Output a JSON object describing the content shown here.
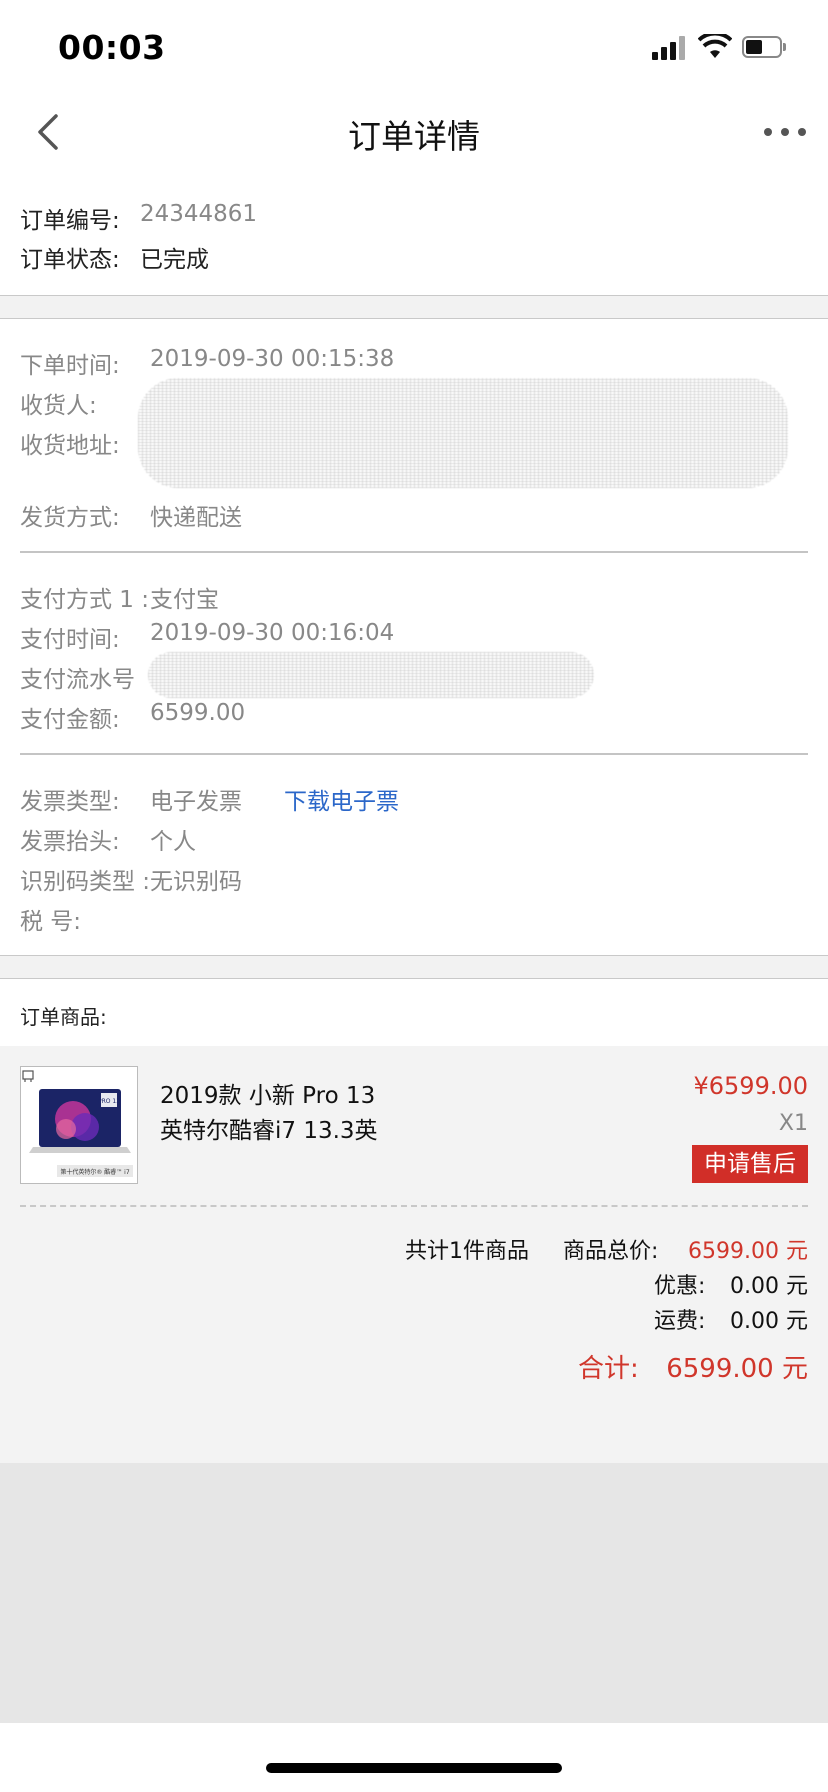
{
  "status_bar": {
    "time": "00:03"
  },
  "nav": {
    "title": "订单详情"
  },
  "order": {
    "number_label": "订单编号:",
    "number_value": "24344861",
    "status_label": "订单状态:",
    "status_value": "已完成"
  },
  "delivery": {
    "order_time_label": "下单时间:",
    "order_time_value": "2019-09-30 00:15:38",
    "receiver_label": "收货人:",
    "address_label": "收货地址:",
    "ship_method_label": "发货方式:",
    "ship_method_value": "快递配送"
  },
  "payment": {
    "method_label": "支付方式 1 :",
    "method_value": "支付宝",
    "time_label": "支付时间:",
    "time_value": "2019-09-30 00:16:04",
    "serial_label": "支付流水号",
    "amount_label": "支付金额:",
    "amount_value": "6599.00"
  },
  "invoice": {
    "type_label": "发票类型:",
    "type_value": "电子发票",
    "download_link": "下载电子票",
    "title_label": "发票抬头:",
    "title_value": "个人",
    "code_type_label": "识别码类型 :",
    "code_type_value": "无识别码",
    "tax_label": "税 号:"
  },
  "goods": {
    "section_title": "订单商品:",
    "item": {
      "name_line1": "2019款 小新 Pro 13",
      "name_line2": "英特尔酷睿i7 13.3英",
      "price": "¥6599.00",
      "quantity": "X1",
      "after_sale_button": "申请售后",
      "thumb_caption": "第十代英特尔® 酷睿™ i7",
      "thumb_badge": "PRO 13"
    },
    "summary": {
      "count_text": "共计1件商品",
      "total_label": "商品总价:",
      "total_value": "6599.00 元",
      "discount_label": "优惠:",
      "discount_value": "0.00 元",
      "shipping_label": "运费:",
      "shipping_value": "0.00 元",
      "grand_label": "合计:",
      "grand_value": "6599.00 元"
    }
  },
  "colors": {
    "accent_red": "#d12e28",
    "link_blue": "#2b67c9"
  }
}
